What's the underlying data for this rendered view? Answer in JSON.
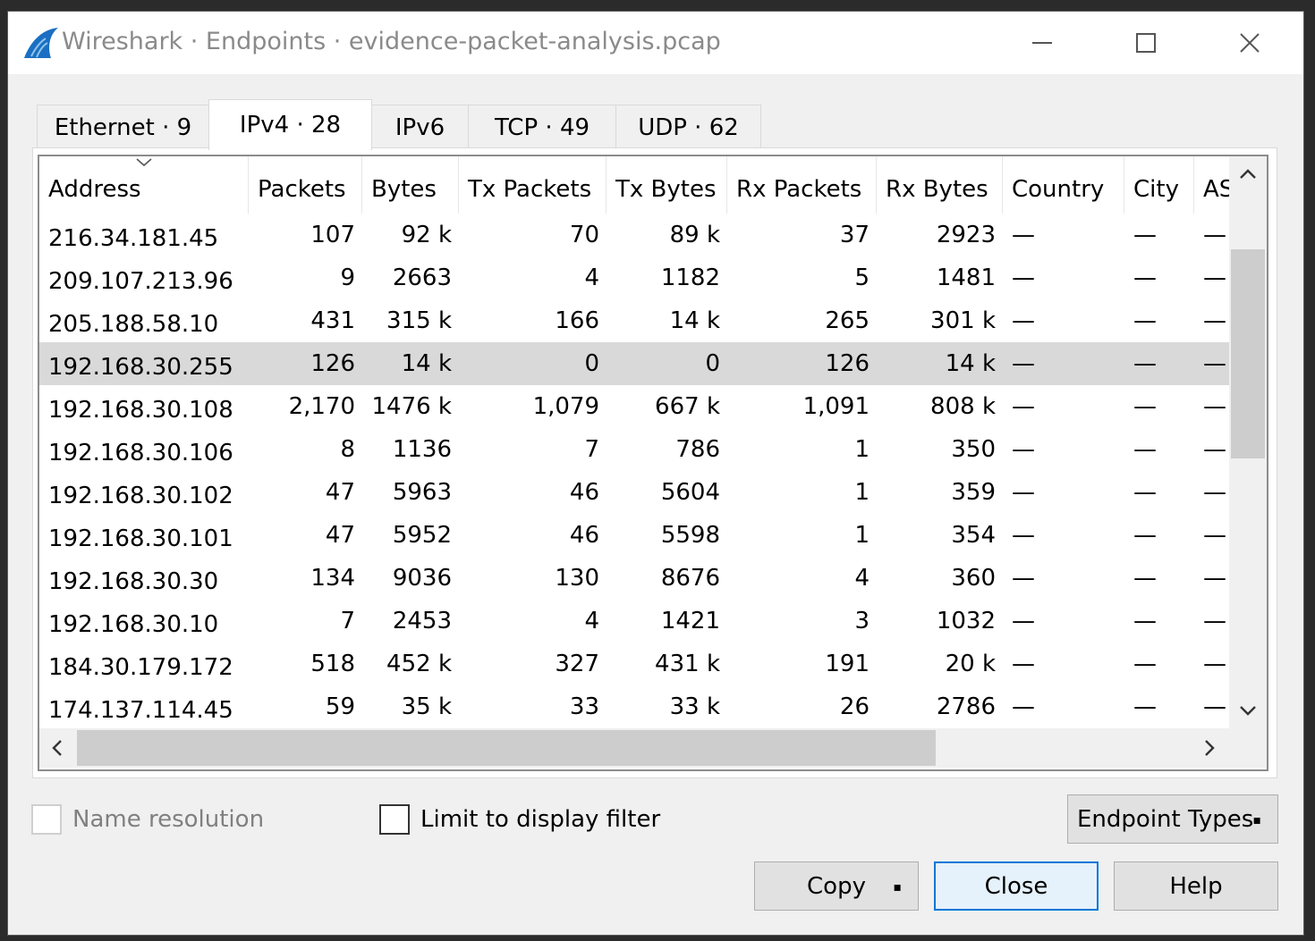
{
  "window": {
    "title": "Wireshark · Endpoints · evidence-packet-analysis.pcap",
    "app_icon": "wireshark-fin-icon",
    "controls": [
      "minimize-icon",
      "maximize-icon",
      "close-icon"
    ]
  },
  "tabs": [
    {
      "label": "Ethernet · 9",
      "active": false
    },
    {
      "label": "IPv4 · 28",
      "active": true
    },
    {
      "label": "IPv6",
      "active": false
    },
    {
      "label": "TCP · 49",
      "active": false
    },
    {
      "label": "UDP · 62",
      "active": false
    }
  ],
  "table": {
    "columns": [
      "Address",
      "Packets",
      "Bytes",
      "Tx Packets",
      "Tx Bytes",
      "Rx Packets",
      "Rx Bytes",
      "Country",
      "City",
      "AS"
    ],
    "rows": [
      [
        "216.34.181.45",
        "107",
        "92 k",
        "70",
        "89 k",
        "37",
        "2923",
        "—",
        "—",
        "—"
      ],
      [
        "209.107.213.96",
        "9",
        "2663",
        "4",
        "1182",
        "5",
        "1481",
        "—",
        "—",
        "—"
      ],
      [
        "205.188.58.10",
        "431",
        "315 k",
        "166",
        "14 k",
        "265",
        "301 k",
        "—",
        "—",
        "—"
      ],
      [
        "192.168.30.255",
        "126",
        "14 k",
        "0",
        "0",
        "126",
        "14 k",
        "—",
        "—",
        "—"
      ],
      [
        "192.168.30.108",
        "2,170",
        "1476 k",
        "1,079",
        "667 k",
        "1,091",
        "808 k",
        "—",
        "—",
        "—"
      ],
      [
        "192.168.30.106",
        "8",
        "1136",
        "7",
        "786",
        "1",
        "350",
        "—",
        "—",
        "—"
      ],
      [
        "192.168.30.102",
        "47",
        "5963",
        "46",
        "5604",
        "1",
        "359",
        "—",
        "—",
        "—"
      ],
      [
        "192.168.30.101",
        "47",
        "5952",
        "46",
        "5598",
        "1",
        "354",
        "—",
        "—",
        "—"
      ],
      [
        "192.168.30.30",
        "134",
        "9036",
        "130",
        "8676",
        "4",
        "360",
        "—",
        "—",
        "—"
      ],
      [
        "192.168.30.10",
        "7",
        "2453",
        "4",
        "1421",
        "3",
        "1032",
        "—",
        "—",
        "—"
      ],
      [
        "184.30.179.172",
        "518",
        "452 k",
        "327",
        "431 k",
        "191",
        "20 k",
        "—",
        "—",
        "—"
      ],
      [
        "174.137.114.45",
        "59",
        "35 k",
        "33",
        "33 k",
        "26",
        "2786",
        "—",
        "—",
        "—"
      ]
    ],
    "selected_row": 3,
    "sort_column": "Address"
  },
  "options": {
    "name_resolution": "Name resolution",
    "limit_filter": "Limit to display filter"
  },
  "buttons": {
    "endpoint_types": "Endpoint Types",
    "copy": "Copy",
    "close": "Close",
    "help": "Help"
  }
}
